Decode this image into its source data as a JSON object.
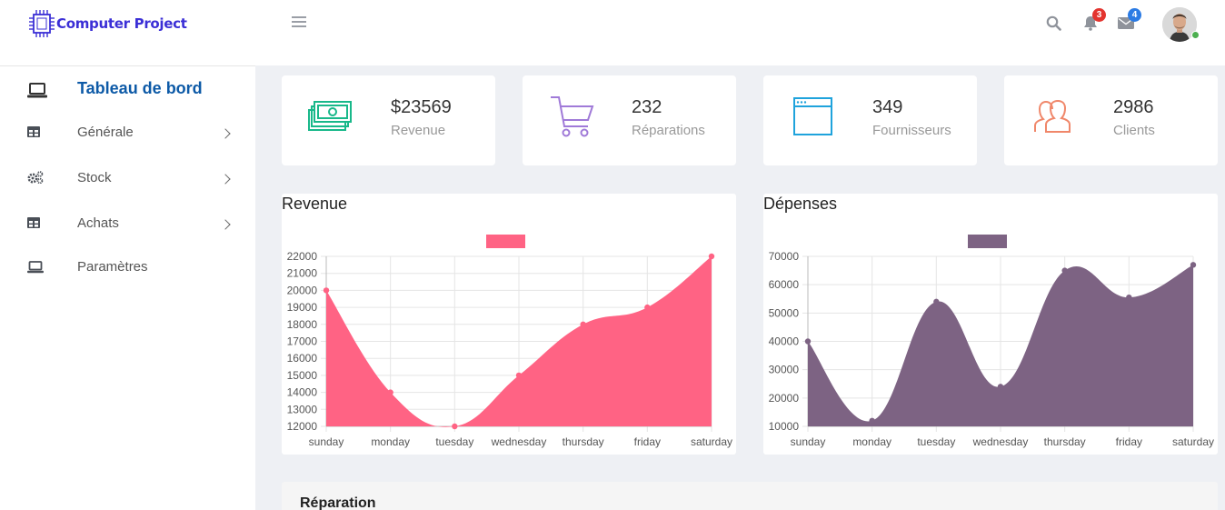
{
  "app": {
    "name": "Computer Project"
  },
  "header": {
    "notifications_count": "3",
    "messages_count": "4",
    "colors": {
      "notif_badge": "#e3342f",
      "msg_badge": "#2b7be4"
    }
  },
  "sidebar": {
    "items": [
      {
        "label": "Tableau de bord",
        "icon": "laptop-icon",
        "active": true
      },
      {
        "label": "Générale",
        "icon": "table-icon",
        "has_children": true
      },
      {
        "label": "Stock",
        "icon": "gears-icon",
        "has_children": true
      },
      {
        "label": "Achats",
        "icon": "table-icon",
        "has_children": true
      },
      {
        "label": "Paramètres",
        "icon": "laptop-icon"
      }
    ]
  },
  "stats": [
    {
      "value": "$23569",
      "label": "Revenue",
      "icon": "money-icon",
      "color": "#19b88a"
    },
    {
      "value": "232",
      "label": "Réparations",
      "icon": "cart-icon",
      "color": "#a07ad8"
    },
    {
      "value": "349",
      "label": "Fournisseurs",
      "icon": "browser-window-icon",
      "color": "#1fa3dc"
    },
    {
      "value": "2986",
      "label": "Clients",
      "icon": "users-icon",
      "color": "#f0876a"
    }
  ],
  "charts": {
    "revenue": {
      "title": "Revenue"
    },
    "depenses": {
      "title": "Dépenses"
    }
  },
  "chart_data": [
    {
      "type": "area",
      "title": "Revenue",
      "categories": [
        "sunday",
        "monday",
        "tuesday",
        "wednesday",
        "thursday",
        "friday",
        "saturday"
      ],
      "series": [
        {
          "values": [
            20000,
            14000,
            12000,
            15000,
            18000,
            19000,
            22000
          ],
          "color": "#ff6384"
        }
      ],
      "ylim": [
        12000,
        22000
      ],
      "yticks": [
        22000,
        21000,
        20000,
        19000,
        18000,
        17000,
        16000,
        15000,
        14000,
        13000,
        12000
      ],
      "grid": true,
      "legend": "top-center"
    },
    {
      "type": "area",
      "title": "Dépenses",
      "categories": [
        "sunday",
        "monday",
        "tuesday",
        "wednesday",
        "thursday",
        "friday",
        "saturday"
      ],
      "series": [
        {
          "values": [
            40000,
            12000,
            54000,
            24000,
            65000,
            55500,
            67000
          ],
          "color": "#7d6383"
        }
      ],
      "ylim": [
        10000,
        70000
      ],
      "yticks": [
        70000,
        60000,
        50000,
        40000,
        30000,
        20000,
        10000
      ],
      "grid": true,
      "legend": "top-center"
    }
  ],
  "bottom_panel": {
    "title": "Réparation"
  }
}
